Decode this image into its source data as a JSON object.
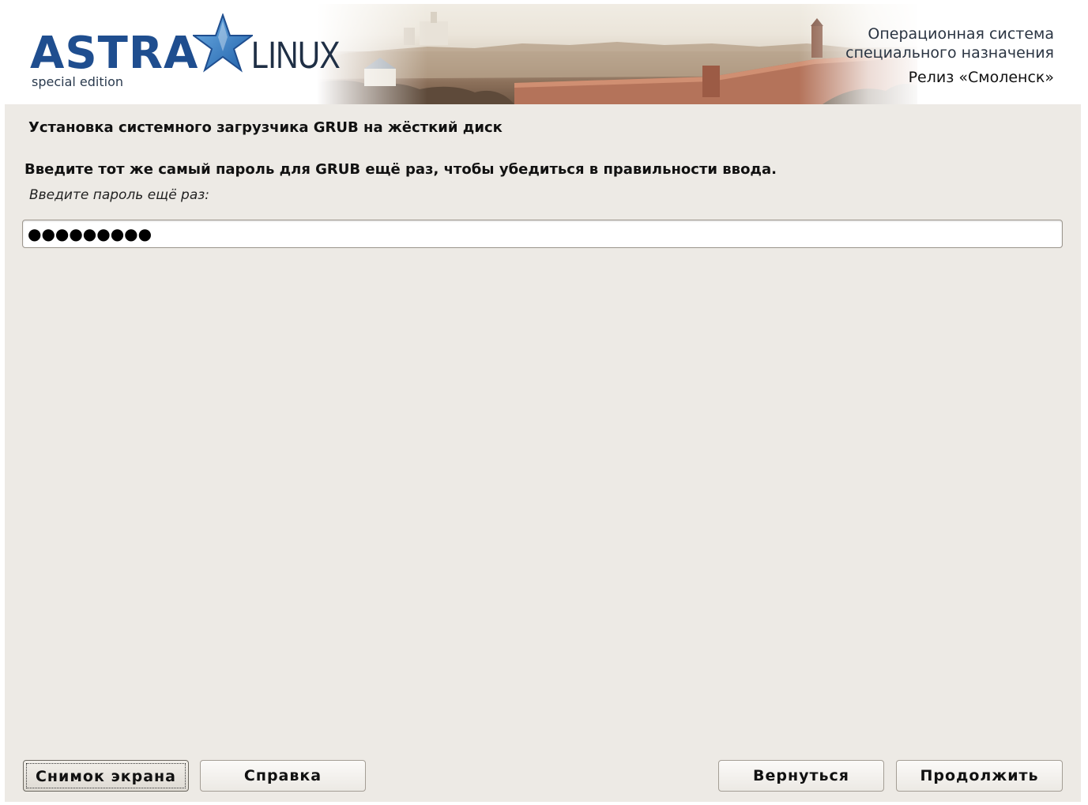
{
  "header": {
    "logo_wordmark": "ASTRA",
    "logo_linux": "LINUX",
    "logo_edition": "special edition",
    "tagline_line1": "Операционная система",
    "tagline_line2": "специального назначения",
    "release": "Релиз «Смоленск»",
    "accent_color": "#1f4e8f"
  },
  "main": {
    "section_title": "Установка системного загрузчика GRUB на жёсткий диск",
    "question": "Введите тот же самый пароль для GRUB ещё раз, чтобы убедиться в правильности ввода.",
    "prompt": "Введите пароль ещё раз:",
    "password_mask": "●●●●●●●●●"
  },
  "buttons": {
    "screenshot": "Снимок экрана",
    "help": "Справка",
    "back": "Вернуться",
    "continue": "Продолжить"
  },
  "icons": {
    "logo_star": "star-icon"
  }
}
